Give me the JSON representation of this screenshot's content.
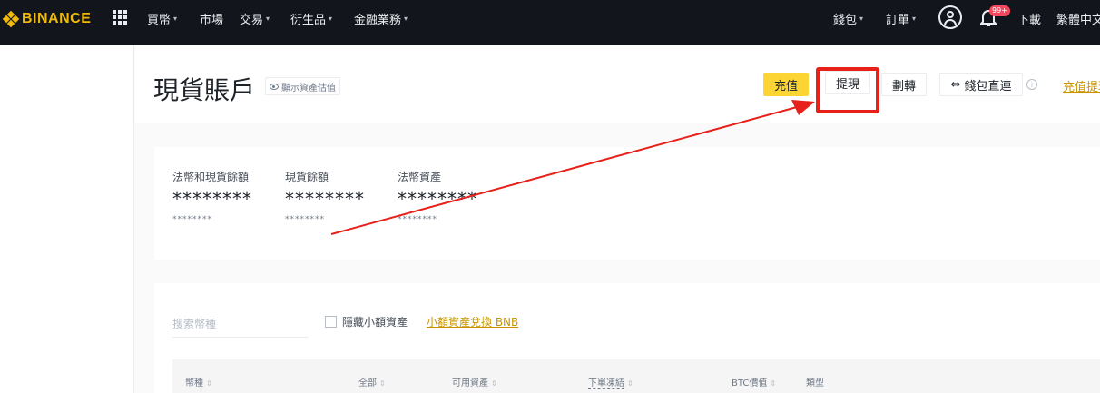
{
  "topbar": {
    "logo_text": "BINANCE",
    "nav": [
      {
        "label": "買幣",
        "dropdown": true
      },
      {
        "label": "市場",
        "dropdown": false
      },
      {
        "label": "交易",
        "dropdown": true
      },
      {
        "label": "衍生品",
        "dropdown": true
      },
      {
        "label": "金融業務",
        "dropdown": true
      }
    ],
    "wallet_label": "錢包",
    "orders_label": "訂單",
    "notification_badge": "99+",
    "download_label": "下載",
    "language_label": "繁體中文",
    "icons": {
      "grid": "grid-icon",
      "avatar": "user-icon",
      "bell": "bell-icon"
    }
  },
  "header": {
    "title": "現貨賬戶",
    "show_estimate_label": "顯示資產估值",
    "deposit_button": "充值",
    "withdraw_button": "提現",
    "transfer_button": "劃轉",
    "wallet_connect_button": "錢包直連",
    "deposit_history_link": "充值提現"
  },
  "balances": [
    {
      "label": "法幣和現貨餘額",
      "value": "********",
      "sub": "********"
    },
    {
      "label": "現貨餘額",
      "value": "********",
      "sub": "********"
    },
    {
      "label": "法幣資產",
      "value": "********",
      "sub": "********"
    }
  ],
  "assets": {
    "search_placeholder": "搜索幣種",
    "hide_small_label": "隱藏小額資產",
    "convert_link": "小額資產兌換 BNB",
    "columns": [
      "幣種",
      "全部",
      "可用資產",
      "下單凍結",
      "BTC價值",
      "類型"
    ]
  },
  "colors": {
    "brand": "#f0b90b",
    "deposit_button": "#fcd535",
    "link": "#c99400",
    "annotation": "#e8201a",
    "topbar_bg": "#12161c"
  }
}
